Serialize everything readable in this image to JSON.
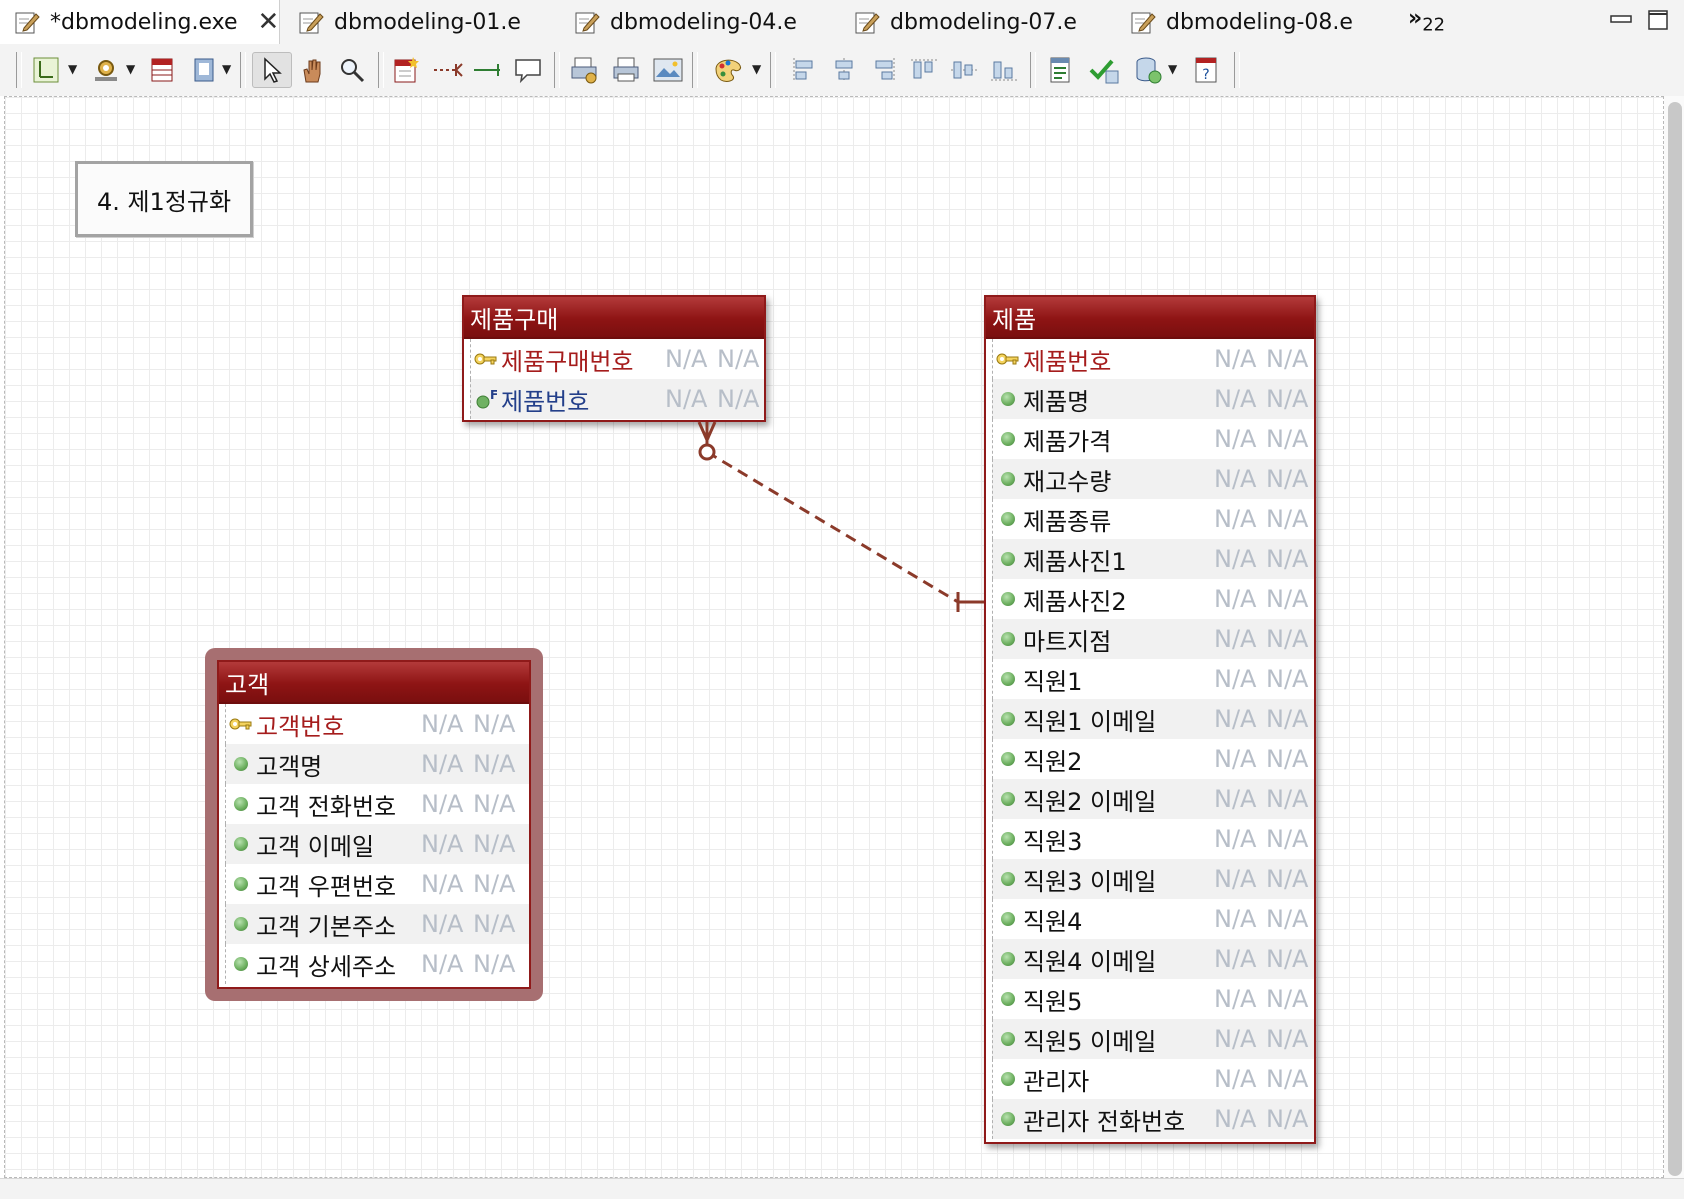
{
  "tabs": [
    {
      "label": "*dbmodeling.exe",
      "active": true,
      "closable": true
    },
    {
      "label": "dbmodeling-01.e"
    },
    {
      "label": "dbmodeling-04.e"
    },
    {
      "label": "dbmodeling-07.e"
    },
    {
      "label": "dbmodeling-08.e"
    }
  ],
  "tab_overflow": {
    "glyph": "»",
    "count": "22"
  },
  "toolbar": {
    "icons": [
      "page-layout-icon",
      "settings-gear-icon",
      "table-icon",
      "notes-icon",
      "select-pointer-icon",
      "hand-pan-icon",
      "zoom-icon",
      "new-table-icon",
      "dashed-relationship-icon",
      "solid-relationship-icon",
      "comment-icon",
      "print-setup-icon",
      "print-icon",
      "image-export-icon",
      "palette-icon",
      "align-left-icon",
      "align-center-icon",
      "align-right-icon",
      "align-top-icon",
      "align-middle-icon",
      "align-bottom-icon",
      "report-icon",
      "validate-icon",
      "database-sync-icon",
      "help-icon"
    ]
  },
  "note": {
    "text": "4. 제1정규화"
  },
  "colors": {
    "entity_header": "#8e1414",
    "pk_text": "#a51c1c",
    "fk_text": "#233f8a",
    "null_text": "#b7bec8",
    "relationship": "#8b3a2a"
  },
  "entities": {
    "purchase": {
      "title": "제품구매",
      "attributes": [
        {
          "name": "제품구매번호",
          "kind": "pk",
          "type": "N/A",
          "nullable": "N/A"
        },
        {
          "name": "제품번호",
          "kind": "fk",
          "type": "N/A",
          "nullable": "N/A"
        }
      ]
    },
    "product": {
      "title": "제품",
      "attributes": [
        {
          "name": "제품번호",
          "kind": "pk",
          "type": "N/A",
          "nullable": "N/A"
        },
        {
          "name": "제품명",
          "kind": "attr",
          "type": "N/A",
          "nullable": "N/A"
        },
        {
          "name": "제품가격",
          "kind": "attr",
          "type": "N/A",
          "nullable": "N/A"
        },
        {
          "name": "재고수량",
          "kind": "attr",
          "type": "N/A",
          "nullable": "N/A"
        },
        {
          "name": "제품종류",
          "kind": "attr",
          "type": "N/A",
          "nullable": "N/A"
        },
        {
          "name": "제품사진1",
          "kind": "attr",
          "type": "N/A",
          "nullable": "N/A"
        },
        {
          "name": "제품사진2",
          "kind": "attr",
          "type": "N/A",
          "nullable": "N/A"
        },
        {
          "name": "마트지점",
          "kind": "attr",
          "type": "N/A",
          "nullable": "N/A"
        },
        {
          "name": "직원1",
          "kind": "attr",
          "type": "N/A",
          "nullable": "N/A"
        },
        {
          "name": "직원1 이메일",
          "kind": "attr",
          "type": "N/A",
          "nullable": "N/A"
        },
        {
          "name": "직원2",
          "kind": "attr",
          "type": "N/A",
          "nullable": "N/A"
        },
        {
          "name": "직원2 이메일",
          "kind": "attr",
          "type": "N/A",
          "nullable": "N/A"
        },
        {
          "name": "직원3",
          "kind": "attr",
          "type": "N/A",
          "nullable": "N/A"
        },
        {
          "name": "직원3 이메일",
          "kind": "attr",
          "type": "N/A",
          "nullable": "N/A"
        },
        {
          "name": "직원4",
          "kind": "attr",
          "type": "N/A",
          "nullable": "N/A"
        },
        {
          "name": "직원4 이메일",
          "kind": "attr",
          "type": "N/A",
          "nullable": "N/A"
        },
        {
          "name": "직원5",
          "kind": "attr",
          "type": "N/A",
          "nullable": "N/A"
        },
        {
          "name": "직원5 이메일",
          "kind": "attr",
          "type": "N/A",
          "nullable": "N/A"
        },
        {
          "name": "관리자",
          "kind": "attr",
          "type": "N/A",
          "nullable": "N/A"
        },
        {
          "name": "관리자 전화번호",
          "kind": "attr",
          "type": "N/A",
          "nullable": "N/A"
        }
      ]
    },
    "customer": {
      "title": "고객",
      "attributes": [
        {
          "name": "고객번호",
          "kind": "pk",
          "type": "N/A",
          "nullable": "N/A"
        },
        {
          "name": "고객명",
          "kind": "attr",
          "type": "N/A",
          "nullable": "N/A"
        },
        {
          "name": "고객 전화번호",
          "kind": "attr",
          "type": "N/A",
          "nullable": "N/A"
        },
        {
          "name": "고객 이메일",
          "kind": "attr",
          "type": "N/A",
          "nullable": "N/A"
        },
        {
          "name": "고객 우편번호",
          "kind": "attr",
          "type": "N/A",
          "nullable": "N/A"
        },
        {
          "name": "고객 기본주소",
          "kind": "attr",
          "type": "N/A",
          "nullable": "N/A"
        },
        {
          "name": "고객 상세주소",
          "kind": "attr",
          "type": "N/A",
          "nullable": "N/A"
        }
      ]
    }
  }
}
